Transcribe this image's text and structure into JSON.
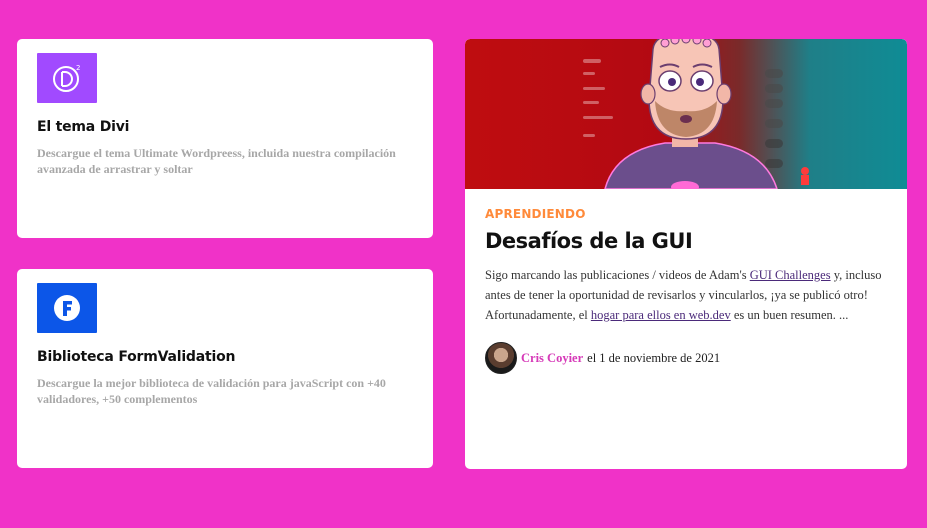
{
  "cards": [
    {
      "logo_icon": "divi-logo-icon",
      "logo_color": "#a14aff",
      "title": "El tema Divi",
      "description": "Descargue el tema Ultimate Wordpreess, incluida nuestra compilación avanzada de arrastrar y soltar"
    },
    {
      "logo_icon": "formvalidation-logo-icon",
      "logo_color": "#0c56e8",
      "title": "Biblioteca FormValidation",
      "description": "Descargue la mejor biblioteca de validación para javaScript con +40 validadores, +50 complementos"
    }
  ],
  "article": {
    "kicker": "APRENDIENDO",
    "title": "Desafíos de la GUI",
    "excerpt": {
      "part1": "Sigo marcando las publicaciones / videos de Adam's ",
      "link1": "GUI Challenges",
      "part2": " y, incluso antes de tener la oportunidad de revisarlos y vincularlos, ¡ya se publicó otro! Afortunadamente, el ",
      "link2": "hogar para ellos en web.dev",
      "part3": " es un buen resumen. ..."
    },
    "author": "Cris Coyier",
    "date_text": "el 1 de noviembre de 2021"
  },
  "colors": {
    "background": "#f032c8",
    "kicker": "#ff8a3a",
    "author_link": "#d63ab8"
  }
}
